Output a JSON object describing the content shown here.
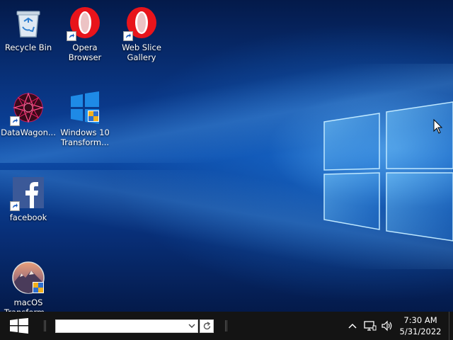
{
  "desktop": {
    "icons": [
      {
        "label": "Recycle Bin",
        "icon": "recycle-bin-icon",
        "shortcut": false
      },
      {
        "label": "Opera\nBrowser",
        "icon": "opera-icon",
        "shortcut": true
      },
      {
        "label": "Web Slice\nGallery",
        "icon": "opera-icon",
        "shortcut": true
      },
      {
        "label": "DataWagon...",
        "icon": "datawagon-icon",
        "shortcut": true
      },
      {
        "label": "Windows 10\nTransform...",
        "icon": "windows-logo-icon",
        "shortcut": false
      },
      {
        "label": "facebook",
        "icon": "facebook-icon",
        "shortcut": true
      },
      {
        "label": "macOS\nTransform...",
        "icon": "macos-icon",
        "shortcut": false
      }
    ]
  },
  "taskbar": {
    "address": {
      "value": "",
      "placeholder": ""
    },
    "clock": {
      "time": "7:30 AM",
      "date": "5/31/2022"
    }
  },
  "colors": {
    "taskbar": "#141414",
    "desktop_accent": "#0c4aa6",
    "opera_red": "#e8141b",
    "facebook_blue": "#3b5998"
  }
}
